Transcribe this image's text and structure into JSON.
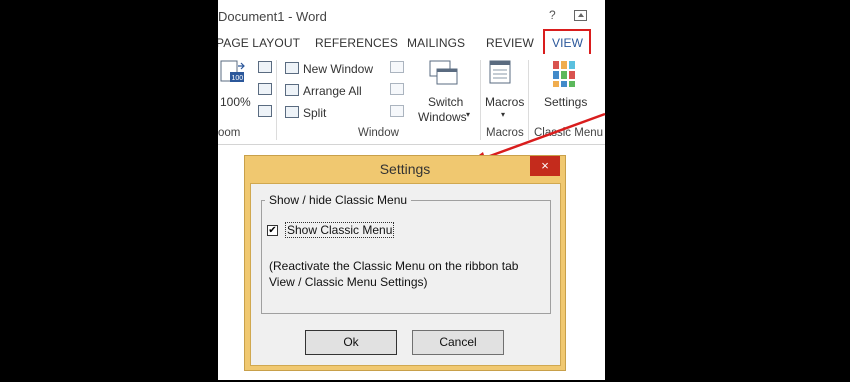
{
  "window": {
    "title": "Document1 - Word",
    "help": "?"
  },
  "tabs": [
    "PAGE LAYOUT",
    "REFERENCES",
    "MAILINGS",
    "REVIEW",
    "VIEW"
  ],
  "ribbon": {
    "zoom_100": "100%",
    "zoom_group": "oom",
    "new_window": "New Window",
    "arrange_all": "Arrange All",
    "split": "Split",
    "switch_windows_1": "Switch",
    "switch_windows_2": "Windows",
    "window_group": "Window",
    "macros": "Macros",
    "macros_group": "Macros",
    "settings": "Settings",
    "classic_menu_group": "Classic Menu"
  },
  "dialog": {
    "title": "Settings",
    "close": "×",
    "group_title": "Show / hide Classic Menu",
    "checkbox_label": "Show Classic Menu",
    "checkbox_checked": true,
    "note": "(Reactivate the Classic Menu on the ribbon tab View / Classic Menu Settings)",
    "ok": "Ok",
    "cancel": "Cancel"
  },
  "colors": {
    "annotation_red": "#d91d1d",
    "dialog_frame": "#f0c870",
    "close_red": "#c42b1c",
    "view_tab": "#2b579a"
  }
}
